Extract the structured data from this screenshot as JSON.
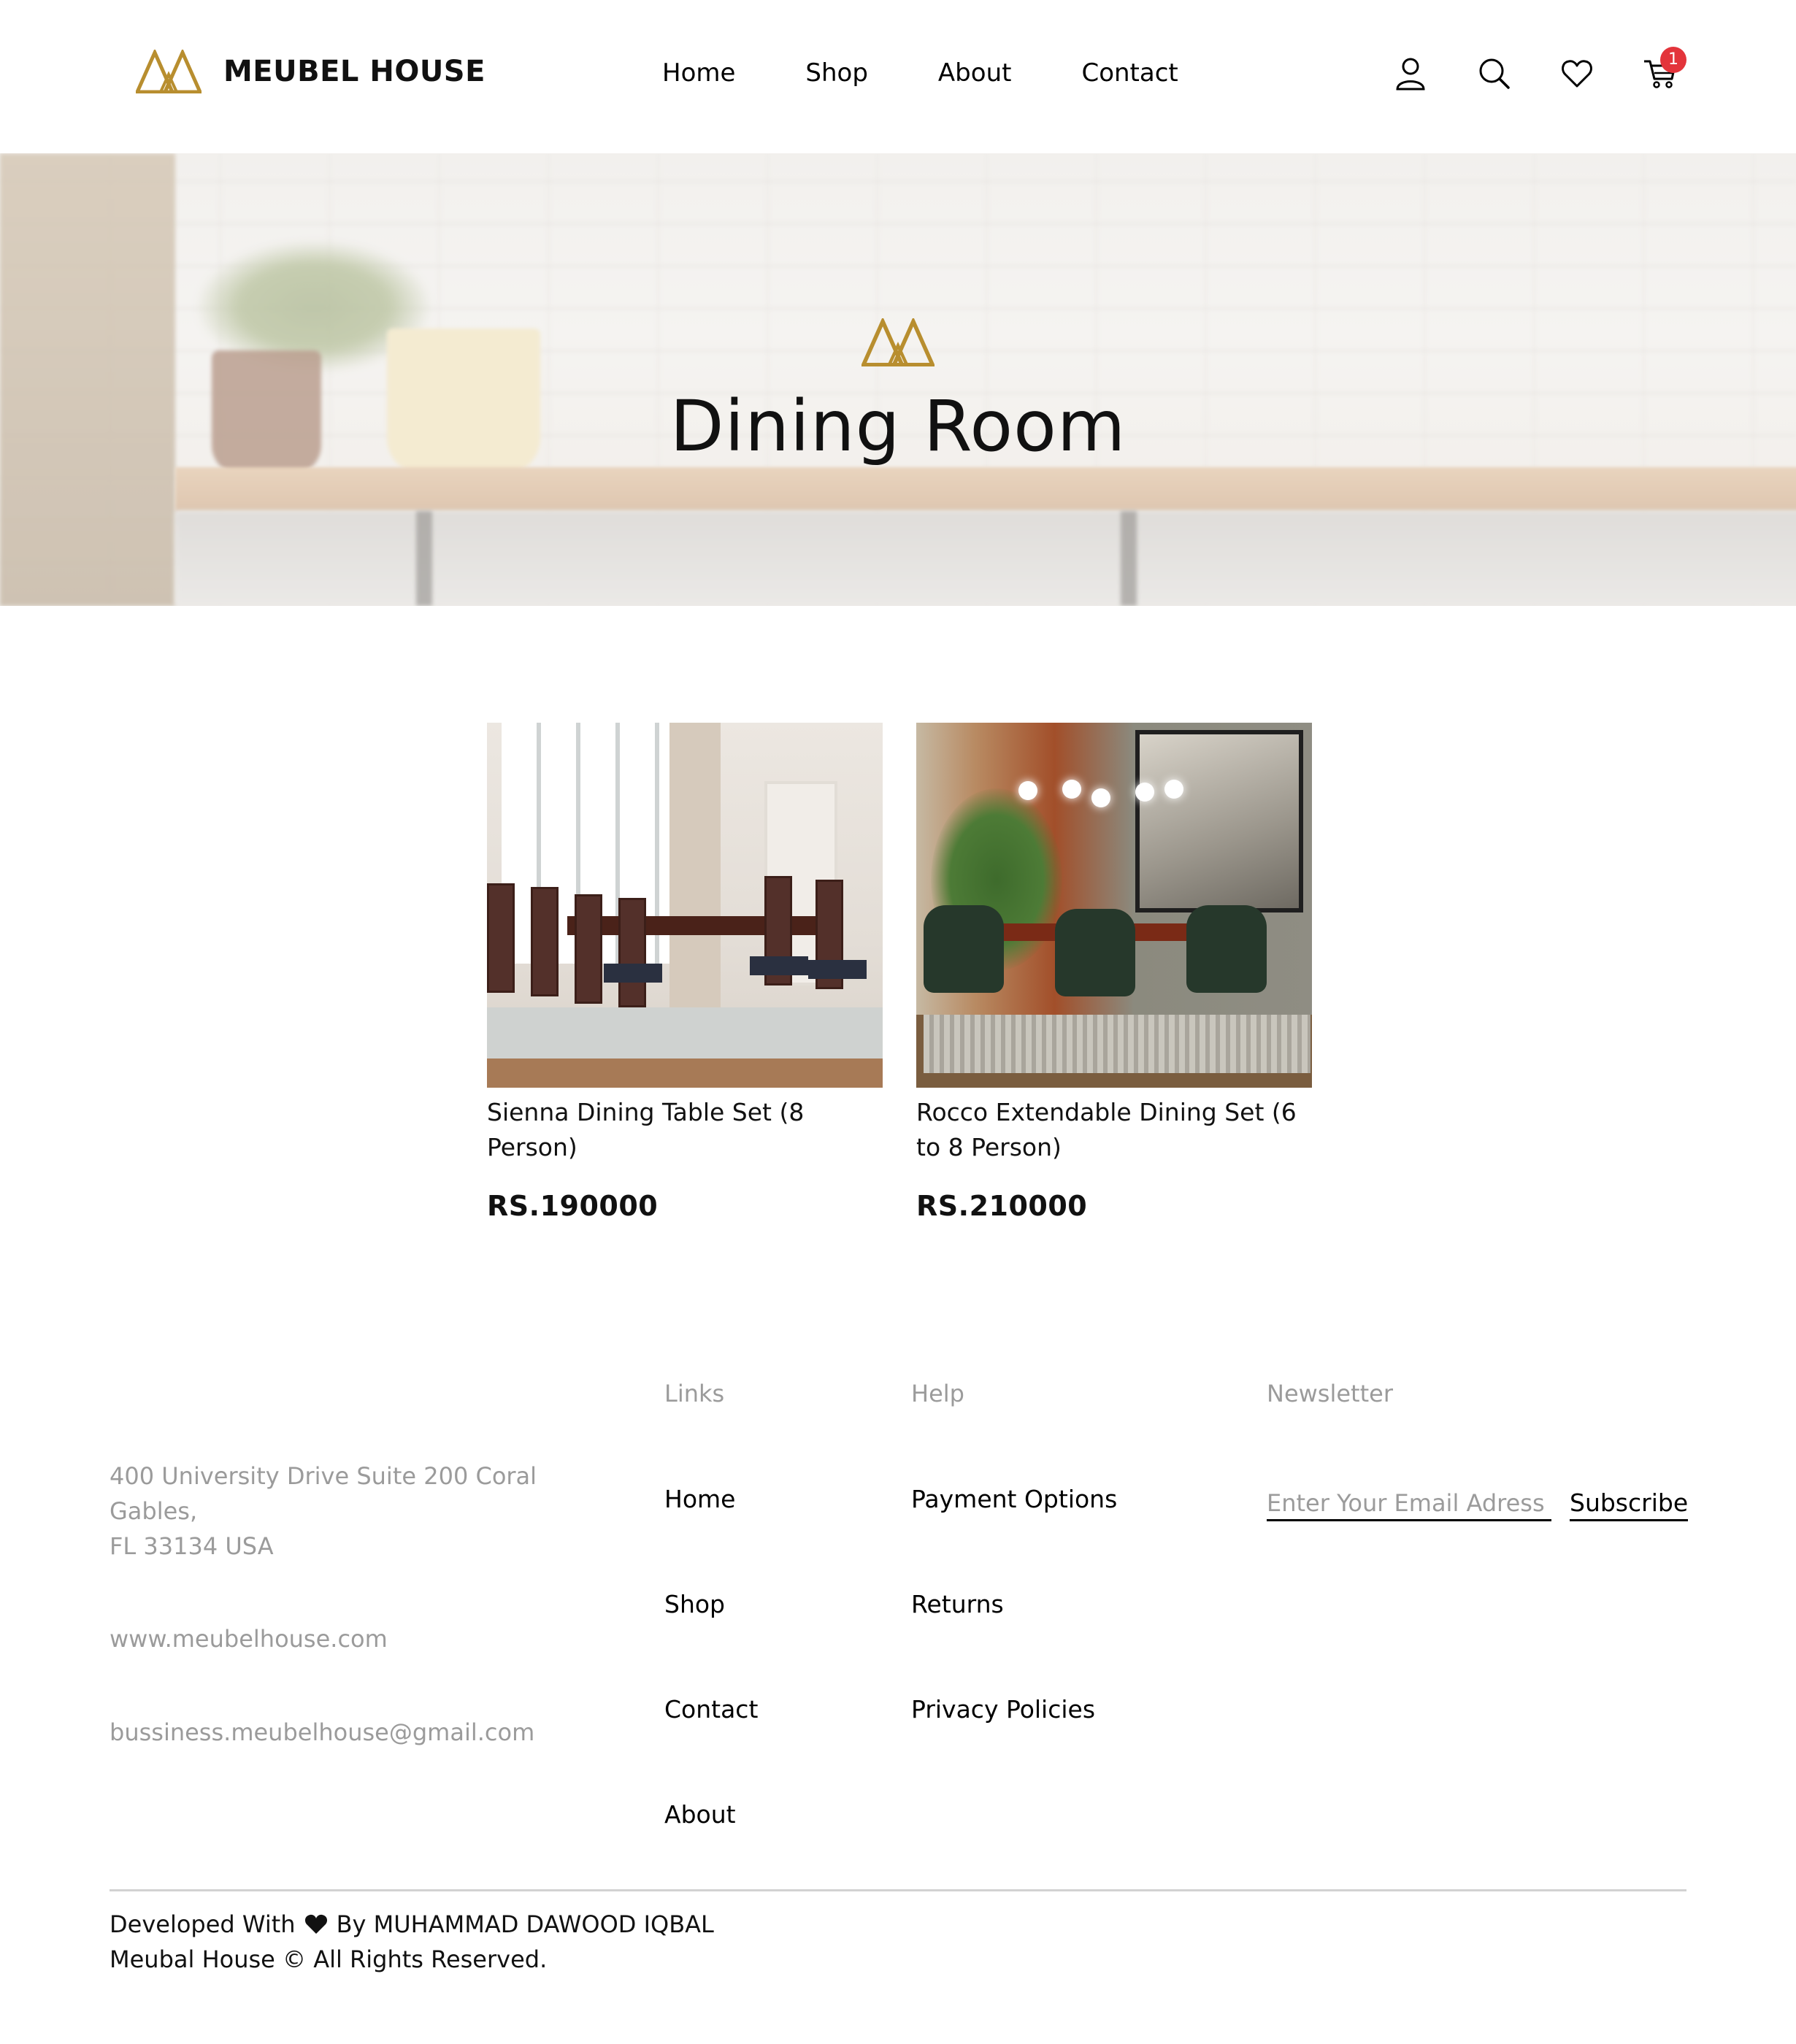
{
  "header": {
    "brand": "MEUBEL HOUSE",
    "nav": [
      "Home",
      "Shop",
      "About",
      "Contact"
    ],
    "icons": [
      "user-icon",
      "search-icon",
      "heart-icon",
      "cart-icon"
    ],
    "cart_count": "1"
  },
  "hero": {
    "title": "Dining Room"
  },
  "products": [
    {
      "name": "Sienna Dining Table Set (8 Person)",
      "price": "RS.190000"
    },
    {
      "name": "Rocco Extendable Dining Set (6 to 8 Person)",
      "price": "RS.210000"
    }
  ],
  "footer": {
    "address_lines": [
      "400 University Drive Suite 200 Coral",
      "Gables,",
      "FL 33134 USA"
    ],
    "website": "www.meubelhouse.com",
    "email": "bussiness.meubelhouse@gmail.com",
    "links_heading": "Links",
    "links": [
      "Home",
      "Shop",
      "Contact",
      "About"
    ],
    "help_heading": "Help",
    "help": [
      "Payment Options",
      "Returns",
      "Privacy Policies"
    ],
    "newsletter_heading": "Newsletter",
    "newsletter_placeholder": "Enter Your Email Adress",
    "subscribe_label": "Subscribe",
    "credits_prefix": "Developed With",
    "credits_suffix": "By MUHAMMAD DAWOOD IQBAL",
    "copyright": "Meubal House © All Rights Reserved."
  },
  "colors": {
    "brand_gold": "#b88e2f",
    "badge_red": "#e3343b",
    "muted_text": "#9b9b9b"
  }
}
